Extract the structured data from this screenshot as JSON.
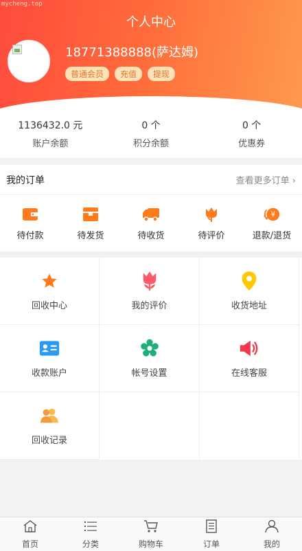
{
  "watermark": "mycheng.top",
  "header": {
    "title": "个人中心",
    "phone": "18771388888(萨达姆)",
    "badges": [
      "普通会员",
      "充值",
      "提现"
    ]
  },
  "stats": [
    {
      "value": "1136432.0 元",
      "label": "账户余额"
    },
    {
      "value": "0 个",
      "label": "积分余额"
    },
    {
      "value": "0 个",
      "label": "优惠券"
    }
  ],
  "orders": {
    "title": "我的订单",
    "more": "查看更多订单",
    "items": [
      {
        "label": "待付款",
        "icon": "wallet-icon"
      },
      {
        "label": "待发货",
        "icon": "box-icon"
      },
      {
        "label": "待收货",
        "icon": "truck-icon"
      },
      {
        "label": "待评价",
        "icon": "flower-icon"
      },
      {
        "label": "退款/退货",
        "icon": "refund-icon"
      }
    ]
  },
  "grid": [
    {
      "label": "回收中心",
      "icon": "star-icon"
    },
    {
      "label": "我的评价",
      "icon": "tulip-icon"
    },
    {
      "label": "收货地址",
      "icon": "location-pin-icon"
    },
    {
      "label": "收款账户",
      "icon": "id-card-icon"
    },
    {
      "label": "帐号设置",
      "icon": "gear-flower-icon"
    },
    {
      "label": "在线客服",
      "icon": "speaker-icon"
    },
    {
      "label": "回收记录",
      "icon": "users-icon"
    }
  ],
  "tabbar": [
    {
      "label": "首页",
      "icon": "home-icon"
    },
    {
      "label": "分类",
      "icon": "list-icon"
    },
    {
      "label": "购物车",
      "icon": "cart-icon"
    },
    {
      "label": "订单",
      "icon": "document-icon"
    },
    {
      "label": "我的",
      "icon": "person-icon"
    }
  ],
  "colors": {
    "accent": "#ff5a3c",
    "orange": "#ff7a1a",
    "badge_bg": "#ffe2b8"
  }
}
